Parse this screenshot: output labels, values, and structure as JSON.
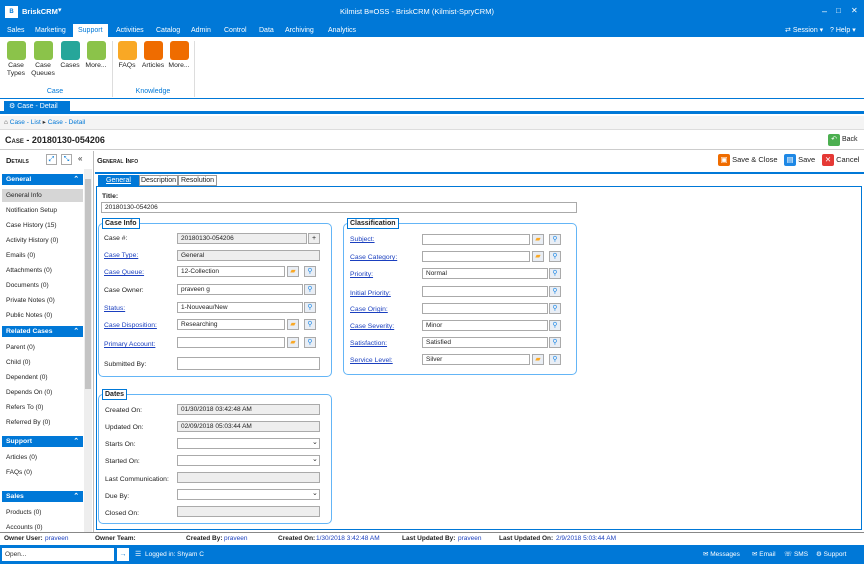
{
  "window": {
    "app": "BriskCRM",
    "title": "Kilmist B≡OSS - BriskCRM (Kilmist-SpryCRM)",
    "controls": [
      "–",
      "□",
      "✕"
    ]
  },
  "menu": {
    "items": [
      "Sales",
      "Marketing",
      "Support",
      "Activities",
      "Catalog",
      "Admin",
      "Control",
      "Data",
      "Archiving",
      "Analytics"
    ],
    "session": "Session",
    "help": "Help"
  },
  "ribbon": {
    "buttons": [
      {
        "label": "Case Types",
        "color": "#8bc34a"
      },
      {
        "label": "Case Queues",
        "color": "#8bc34a"
      },
      {
        "label": "Cases",
        "color": "#26a69a"
      },
      {
        "label": "More...",
        "color": "#8bc34a"
      },
      {
        "label": "FAQs",
        "color": "#f9a825"
      },
      {
        "label": "Articles",
        "color": "#ef6c00"
      },
      {
        "label": "More...",
        "color": "#ef6c00"
      }
    ],
    "groups": [
      "Case",
      "Knowledge"
    ]
  },
  "tab": {
    "label": "Case - Detail"
  },
  "breadcrumb": [
    "Case - List",
    "Case - Detail"
  ],
  "page": {
    "title": "Case - 20180130-054206",
    "back": "Back"
  },
  "sidebar": {
    "title": "Details",
    "sections": [
      {
        "title": "General",
        "items": [
          "General Info",
          "Notification Setup",
          "Case History (15)",
          "Activity History (0)",
          "Emails (0)",
          "Attachments (0)",
          "Documents (0)",
          "Private Notes (0)",
          "Public Notes (0)"
        ]
      },
      {
        "title": "Related Cases",
        "items": [
          "Parent (0)",
          "Child (0)",
          "Dependent (0)",
          "Depends On (0)",
          "Refers To (0)",
          "Referred By (0)"
        ]
      },
      {
        "title": "Support",
        "items": [
          "Articles (0)",
          "FAQs (0)"
        ]
      },
      {
        "title": "Sales",
        "items": [
          "Products (0)",
          "Accounts (0)"
        ]
      }
    ]
  },
  "main": {
    "header": "General Info",
    "actions": {
      "save_close": "Save & Close",
      "save": "Save",
      "cancel": "Cancel"
    },
    "tabs": [
      "General",
      "Description",
      "Resolution"
    ],
    "title_label": "Title:",
    "title_value": "20180130-054206",
    "case_info": {
      "label": "Case Info",
      "fields": [
        {
          "label": "Case #:",
          "value": "20180130-054206",
          "link": false
        },
        {
          "label": "Case Type:",
          "value": "General",
          "link": true
        },
        {
          "label": "Case Queue:",
          "value": "12-Collection",
          "link": true
        },
        {
          "label": "Case Owner:",
          "value": "praveen g",
          "link": false
        },
        {
          "label": "Status:",
          "value": "1-Nouveau/New",
          "link": true
        },
        {
          "label": "Case Disposition:",
          "value": "Researching",
          "link": true
        },
        {
          "label": "Primary Account:",
          "value": "",
          "link": true
        },
        {
          "label": "Submitted By:",
          "value": "",
          "link": false
        }
      ]
    },
    "classification": {
      "label": "Classification",
      "fields": [
        {
          "label": "Subject:",
          "value": ""
        },
        {
          "label": "Case Category:",
          "value": ""
        },
        {
          "label": "Priority:",
          "value": "Normal"
        },
        {
          "label": "Initial Priority:",
          "value": ""
        },
        {
          "label": "Case Origin:",
          "value": ""
        },
        {
          "label": "Case Severity:",
          "value": "Minor"
        },
        {
          "label": "Satisfaction:",
          "value": "Satisfied"
        },
        {
          "label": "Service Level:",
          "value": "Silver"
        }
      ]
    },
    "dates": {
      "label": "Dates",
      "fields": [
        {
          "label": "Created On:",
          "value": "01/30/2018 03:42:48 AM"
        },
        {
          "label": "Updated On:",
          "value": "02/09/2018 05:03:44 AM"
        },
        {
          "label": "Starts On:",
          "value": ""
        },
        {
          "label": "Started On:",
          "value": ""
        },
        {
          "label": "Last Communication:",
          "value": ""
        },
        {
          "label": "Due By:",
          "value": ""
        },
        {
          "label": "Closed On:",
          "value": ""
        }
      ]
    }
  },
  "statusbar": {
    "owner_user_label": "Owner User:",
    "owner_user": "praveen",
    "owner_team_label": "Owner Team:",
    "created_by_label": "Created By:",
    "created_by": "praveen",
    "created_on_label": "Created On:",
    "created_on": "1/30/2018 3:42:48 AM",
    "updated_by_label": "Last Updated By:",
    "updated_by": "praveen",
    "updated_on_label": "Last Updated On:",
    "updated_on": "2/9/2018 5:03:44 AM"
  },
  "bottombar": {
    "open_placeholder": "Open...",
    "logged_in": "Logged in: Shyam C",
    "links": [
      "Messages",
      "Email",
      "SMS",
      "Support"
    ]
  }
}
